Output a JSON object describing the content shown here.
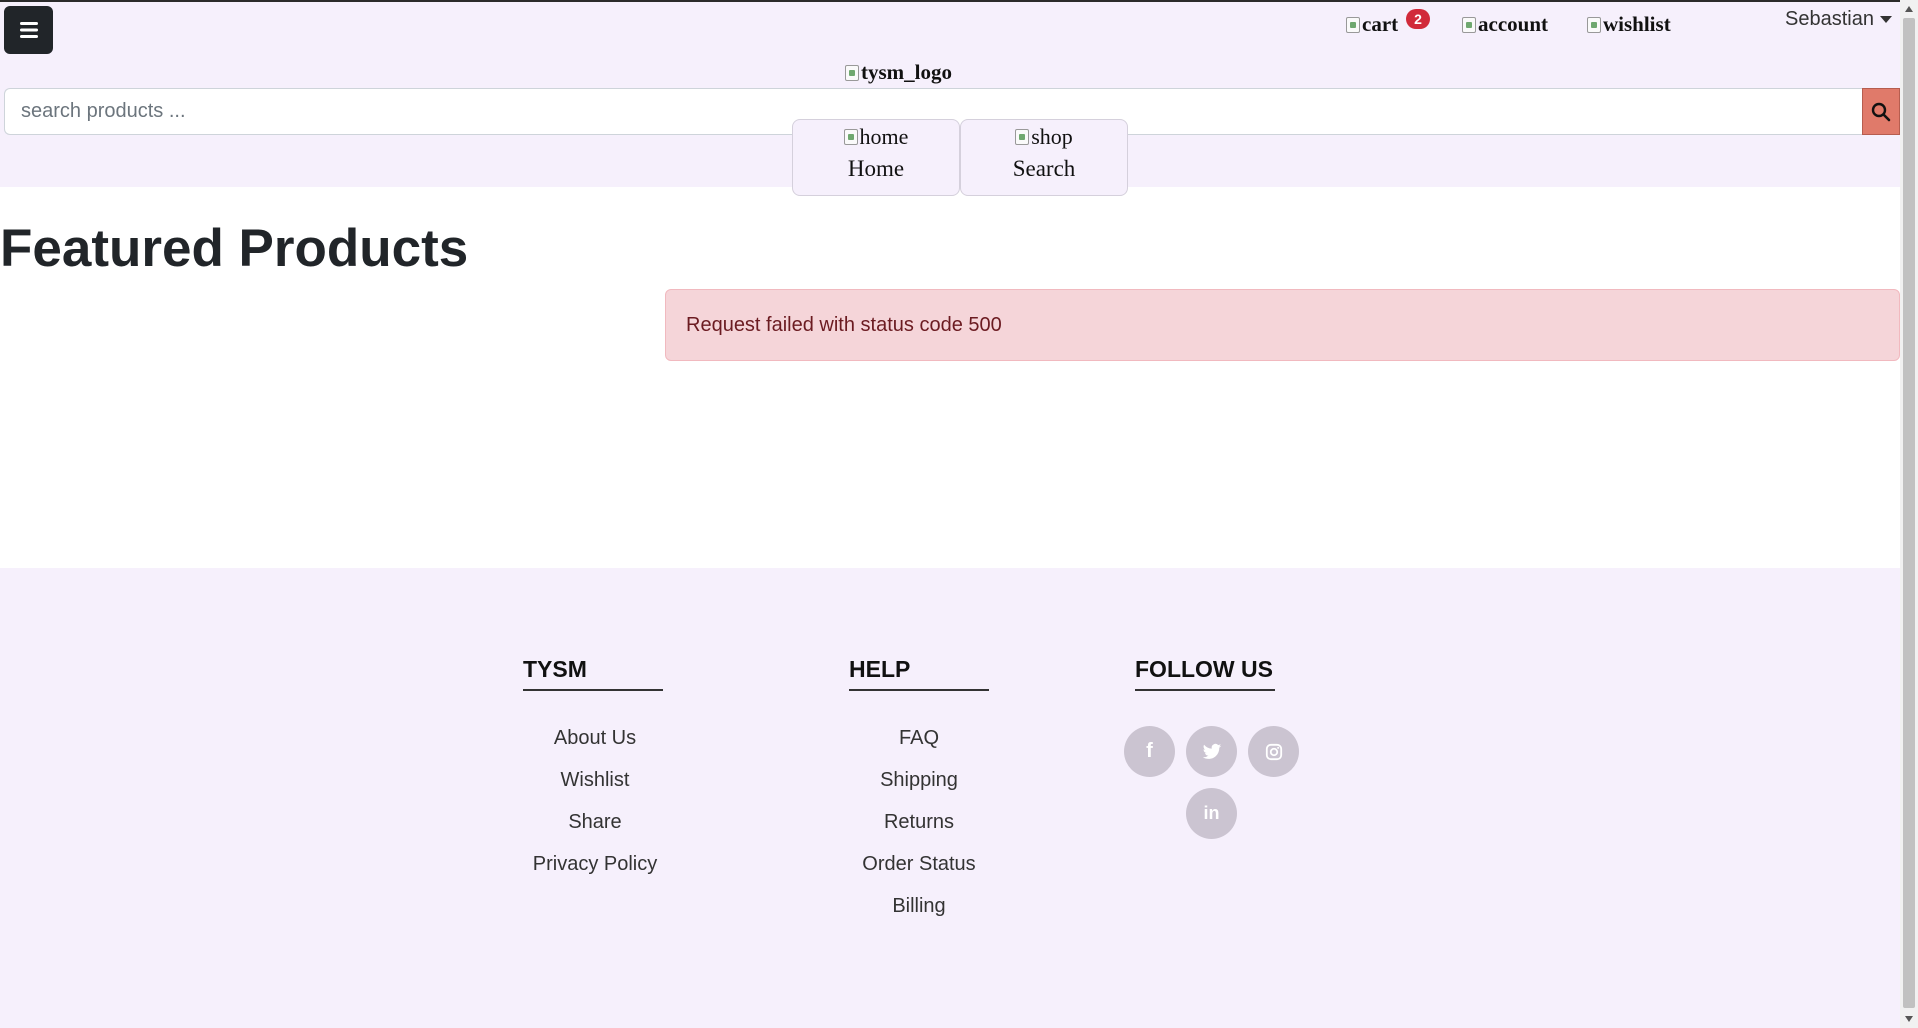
{
  "header": {
    "cart_alt": "cart",
    "cart_count": "2",
    "account_alt": "account",
    "wishlist_alt": "wishlist",
    "user_name": "Sebastian",
    "logo_alt": "tysm_logo",
    "search_placeholder": "search products ...",
    "nav": [
      {
        "icon_alt": "home",
        "label": "Home"
      },
      {
        "icon_alt": "shop",
        "label": "Search"
      }
    ]
  },
  "main": {
    "title": "Featured Products",
    "error_message": "Request failed with status code 500"
  },
  "footer": {
    "columns": [
      {
        "heading": "TYSM",
        "links": [
          "About Us",
          "Wishlist",
          "Share",
          "Privacy Policy"
        ]
      },
      {
        "heading": "HELP",
        "links": [
          "FAQ",
          "Shipping",
          "Returns",
          "Order Status",
          "Billing"
        ]
      },
      {
        "heading": "FOLLOW US"
      }
    ],
    "social": [
      "facebook-icon",
      "twitter-icon",
      "instagram-icon",
      "linkedin-icon"
    ]
  },
  "colors": {
    "header_bg": "#f6f0fc",
    "accent_search": "#e07a6a",
    "badge": "#d12a3a",
    "alert_bg": "#f5d5d9"
  }
}
